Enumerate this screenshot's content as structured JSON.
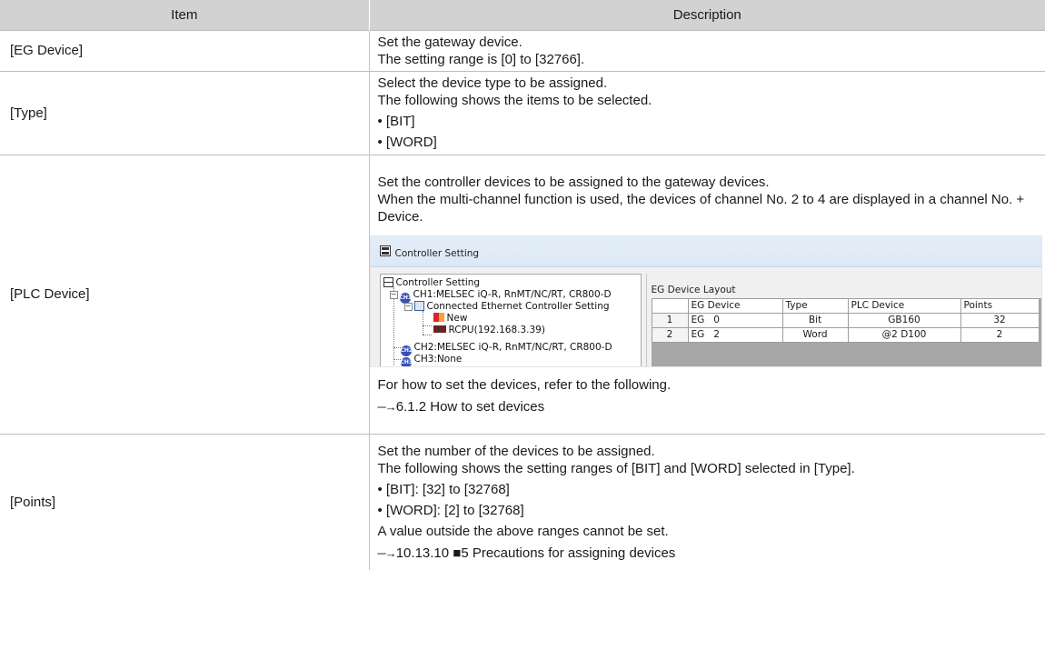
{
  "table": {
    "headers": {
      "item": "Item",
      "description": "Description"
    },
    "rows": [
      {
        "item": "[EG Device]",
        "lines": [
          "Set the gateway device.",
          "The setting range is [0] to [32766]."
        ]
      },
      {
        "item": "[Type]",
        "lines": [
          "Select the device type to be assigned.",
          "The following shows the items to be selected."
        ],
        "bullets": [
          "• [BIT]",
          "• [WORD]"
        ]
      },
      {
        "item": "[PLC Device]",
        "lines": [
          "Set the controller devices to be assigned to the gateway devices.",
          "When the multi-channel function is used, the devices of channel No. 2 to 4 are displayed in a channel No. + Device."
        ],
        "after": "For how to set the devices, refer to the following.",
        "ref": "6.1.2 How to set devices"
      },
      {
        "item": "[Points]",
        "lines": [
          "Set the number of the devices to be assigned.",
          "The following shows the setting ranges of [BIT] and [WORD] selected in [Type]."
        ],
        "bullets": [
          "• [BIT]: [32] to [32768]",
          "• [WORD]: [2] to [32768]"
        ],
        "after": "A value outside the above ranges cannot be set.",
        "ref": "10.13.10 ■5 Precautions for assigning devices"
      }
    ]
  },
  "ref_arrow": "→",
  "screenshot": {
    "window_title": "Controller Setting",
    "tree": {
      "root": "Controller Setting",
      "ch1": "CH1:MELSEC iQ-R, RnMT/NC/RT, CR800-D",
      "ch1_chip": "CH1",
      "connected": "Connected Ethernet Controller Setting",
      "new": "New",
      "rcpu": "RCPU(192.168.3.39)",
      "ch2": "CH2:MELSEC iQ-R, RnMT/NC/RT, CR800-D",
      "ch2_chip": "CH2",
      "ch3": "CH3:None",
      "ch3_chip": "CH3"
    },
    "layout_title": "EG Device Layout",
    "grid": {
      "headers": [
        "EG Device",
        "Type",
        "PLC Device",
        "Points"
      ],
      "rows": [
        {
          "no": "1",
          "eg": "EG",
          "eg_no": "0",
          "type": "Bit",
          "plc": "GB160",
          "points": "32"
        },
        {
          "no": "2",
          "eg": "EG",
          "eg_no": "2",
          "type": "Word",
          "plc": "@2 D100",
          "points": "2"
        }
      ]
    }
  }
}
